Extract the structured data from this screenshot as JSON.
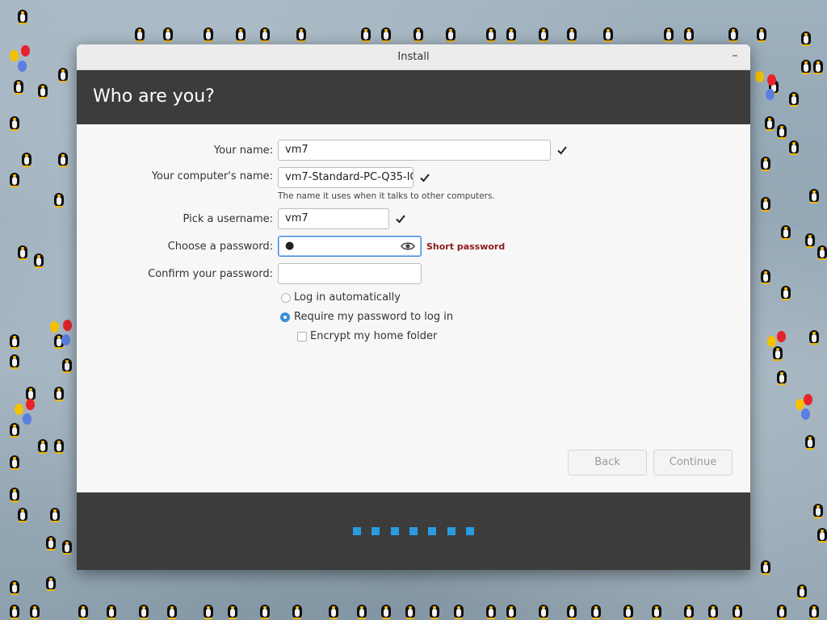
{
  "window": {
    "title": "Install",
    "minimize_glyph": "–"
  },
  "header": {
    "title": "Who are you?"
  },
  "form": {
    "name_label": "Your name:",
    "name_value": "vm7",
    "computer_label": "Your computer's name:",
    "computer_value": "vm7-Standard-PC-Q35-IC",
    "computer_hint": "The name it uses when it talks to other computers.",
    "username_label": "Pick a username:",
    "username_value": "vm7",
    "password_label": "Choose a password:",
    "password_value": "●",
    "password_strength": "Short password",
    "confirm_label": "Confirm your password:",
    "confirm_value": ""
  },
  "options": {
    "auto_login_label": "Log in automatically",
    "auto_login_selected": false,
    "require_password_label": "Require my password to log in",
    "require_password_selected": true,
    "encrypt_label": "Encrypt my home folder",
    "encrypt_checked": false
  },
  "buttons": {
    "back": "Back",
    "continue": "Continue"
  },
  "progress": {
    "steps": 7
  },
  "colors": {
    "accent": "#3a8ed8",
    "progress_dot": "#2b9be0",
    "warning": "#8b1a1a",
    "header_bg": "#3c3c3c"
  },
  "icons": {
    "valid": "checkmark-icon",
    "reveal": "eye-icon",
    "minimize": "minimize-icon"
  }
}
